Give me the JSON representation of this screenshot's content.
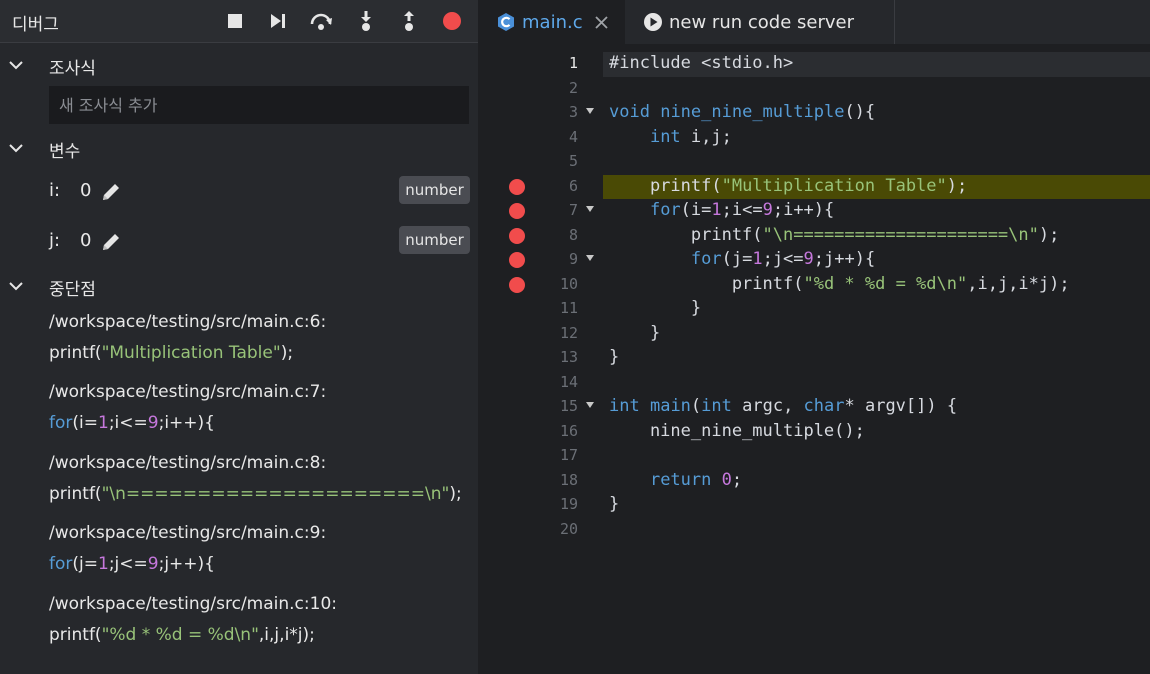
{
  "debug": {
    "title": "디버그",
    "controls": [
      {
        "name": "stop-icon"
      },
      {
        "name": "continue-icon"
      },
      {
        "name": "step-over-icon"
      },
      {
        "name": "step-into-icon"
      },
      {
        "name": "step-out-icon"
      },
      {
        "name": "record-icon"
      }
    ],
    "watch": {
      "label": "조사식",
      "placeholder": "새 조사식 추가"
    },
    "variables": {
      "label": "변수",
      "items": [
        {
          "name": "i:",
          "value": "0",
          "type": "number"
        },
        {
          "name": "j:",
          "value": "0",
          "type": "number"
        }
      ]
    },
    "breakpoints": {
      "label": "중단점",
      "items": [
        {
          "path": "/workspace/testing/src/main.c:6:"
        },
        {
          "path": "/workspace/testing/src/main.c:7:"
        },
        {
          "path": "/workspace/testing/src/main.c:8:"
        },
        {
          "path": "/workspace/testing/src/main.c:9:"
        },
        {
          "path": "/workspace/testing/src/main.c:10:"
        }
      ]
    }
  },
  "editor": {
    "tabs": [
      {
        "label": "main.c",
        "icon": "c-language-icon",
        "active": true
      },
      {
        "label": "new run code server",
        "icon": "play-icon",
        "active": false
      }
    ],
    "line_numbers": [
      "1",
      "2",
      "3",
      "4",
      "5",
      "6",
      "7",
      "8",
      "9",
      "10",
      "11",
      "12",
      "13",
      "14",
      "15",
      "16",
      "17",
      "18",
      "19",
      "20"
    ],
    "breakpoint_lines": [
      6,
      7,
      8,
      9,
      10
    ],
    "highlight_line": 6,
    "fold_lines": [
      3,
      7,
      9
    ]
  },
  "colors": {
    "breakpoint": "#f14c4c",
    "keyword": "#569cd6",
    "string": "#98c379",
    "number": "#c678dd",
    "highlight": "#4a4a05"
  }
}
